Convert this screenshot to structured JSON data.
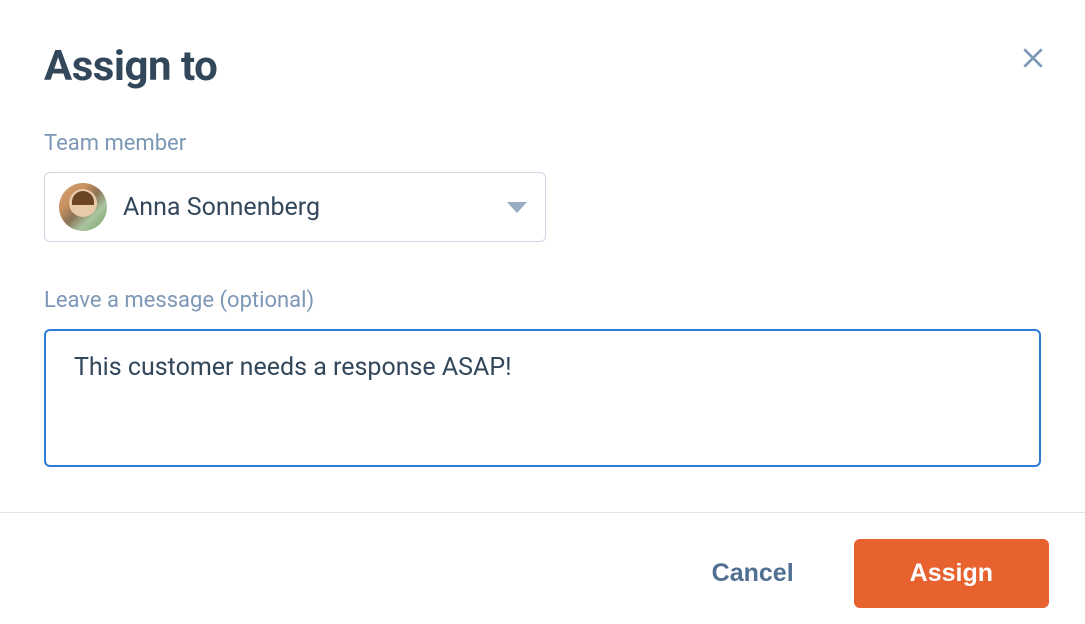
{
  "modal": {
    "title": "Assign to",
    "team_member_label": "Team member",
    "selected_member_name": "Anna Sonnenberg",
    "message_label": "Leave a message (optional)",
    "message_value": "This customer needs a response ASAP!",
    "cancel_label": "Cancel",
    "assign_label": "Assign"
  }
}
